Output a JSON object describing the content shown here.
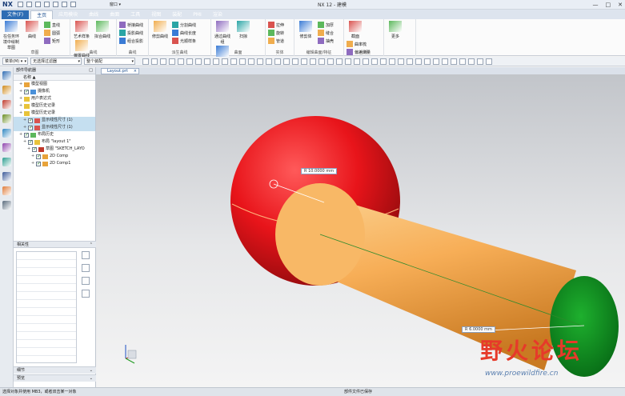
{
  "app": {
    "logo": "NX",
    "title": "NX 12 - 建模",
    "window_menu": "窗口 ▾",
    "window_buttons": [
      "—",
      "□",
      "✕"
    ]
  },
  "ribbon_tabs": [
    "文件(F)",
    "主页",
    "应用模块",
    "曲线",
    "曲面",
    "工具",
    "视图",
    "装配",
    "PMI",
    "渲染"
  ],
  "ribbon_active": 1,
  "ribbon_groups": [
    {
      "label": "草图",
      "big": [
        "在任务环境中绘制草图",
        "曲线"
      ],
      "small": [
        "直线",
        "圆弧",
        "矩形"
      ]
    },
    {
      "label": "曲线",
      "big": [
        "艺术样条",
        "拟合曲线",
        "偏置曲线"
      ],
      "small": []
    },
    {
      "label": "曲线",
      "big": [],
      "small": [
        "桥接曲线",
        "投影曲线",
        "组合投影"
      ]
    },
    {
      "label": "派生曲线",
      "big": [
        "修剪曲线"
      ],
      "small": [
        "分割曲线",
        "曲线长度",
        "光顺样条"
      ]
    },
    {
      "label": "曲面",
      "big": [
        "通过曲线组",
        "扫掠",
        "N边曲面"
      ],
      "small": []
    },
    {
      "label": "实体",
      "big": [],
      "small": [
        "拉伸",
        "旋转",
        "管道"
      ]
    },
    {
      "label": "编辑曲面/特征",
      "big": [
        "修剪体"
      ],
      "small": [
        "加厚",
        "缝合",
        "抽壳"
      ]
    },
    {
      "label": "分析",
      "big": [
        "截面"
      ],
      "small": [
        "曲率梳",
        "偏差测量",
        "斑马线"
      ]
    },
    {
      "label": "",
      "big": [
        "更多"
      ],
      "small": []
    }
  ],
  "selection_bar": {
    "filter": "菜单(M) ▾",
    "type_filter": "无选择过滤器",
    "scope": "整个装配"
  },
  "doc_tab": "Layout.prt",
  "navigator": {
    "title": "部件导航器",
    "column": "名称 ▲",
    "nodes": [
      {
        "label": "模型视图",
        "indent": 1,
        "check": false,
        "selected": false
      },
      {
        "label": "摄像机",
        "indent": 1,
        "check": true,
        "selected": false
      },
      {
        "label": "用户表达式",
        "indent": 1,
        "check": false,
        "selected": false
      },
      {
        "label": "模型历史记录",
        "indent": 1,
        "check": false,
        "selected": false
      },
      {
        "label": "模型历史记录",
        "indent": 1,
        "check": false,
        "selected": false
      },
      {
        "label": "显示线性尺寸 (1)",
        "indent": 2,
        "check": true,
        "selected": true
      },
      {
        "label": "显示线性尺寸 (1)",
        "indent": 2,
        "check": true,
        "selected": true
      },
      {
        "label": "布局历史",
        "indent": 1,
        "check": true,
        "selected": false
      },
      {
        "label": "布局 \"layout 1\"",
        "indent": 2,
        "check": true,
        "selected": false
      },
      {
        "label": "草图 \"SKETCH_LAYO",
        "indent": 3,
        "check": true,
        "selected": false
      },
      {
        "label": "2D Comp",
        "indent": 4,
        "check": true,
        "selected": false
      },
      {
        "label": "2D Comp1",
        "indent": 4,
        "check": true,
        "selected": false
      }
    ],
    "dependencies_title": "相关性",
    "details_title": "细节",
    "preview_title": "预览"
  },
  "resource_icons": [
    "part-nav-icon",
    "assembly-nav-icon",
    "constraint-nav-icon",
    "reuse-library-icon",
    "hd3d-icon",
    "web-browser-icon",
    "history-icon",
    "process-studio-icon",
    "roles-icon",
    "system-materials-icon"
  ],
  "colors": {
    "sphere": "#e8141a",
    "cylinder": "#f7ae57",
    "end_face": "#0e8a1e",
    "ribbon_blue": "#2f6cb3"
  },
  "dimensions": {
    "sphere": "R 10.0000 mm",
    "cylinder": "R 6.0000 mm"
  },
  "watermark": {
    "text": "野火论坛",
    "url": "www.proewildfire.cn"
  },
  "status": {
    "left": "选择对象并使用 MB3，或者双击某一对象",
    "center": "部件文件已保存"
  }
}
